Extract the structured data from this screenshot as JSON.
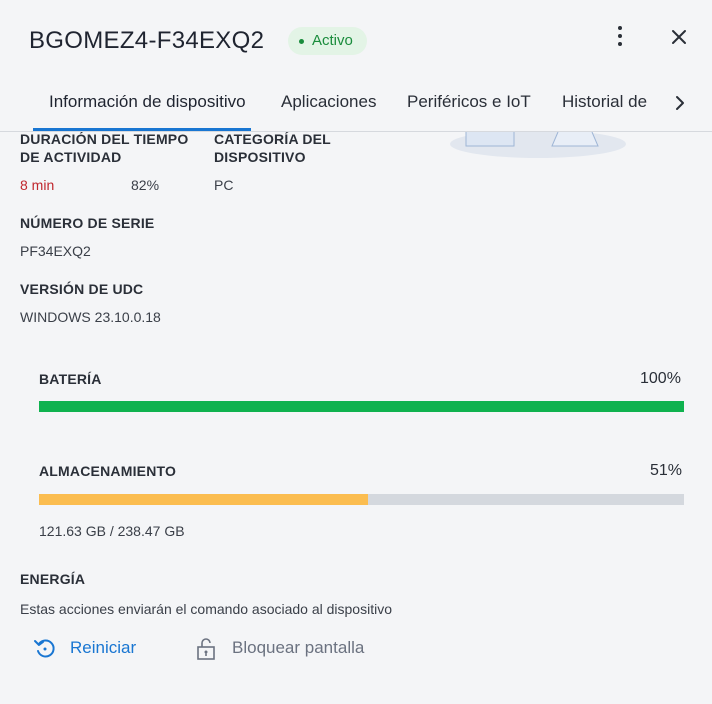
{
  "header": {
    "title": "BGOMEZ4-F34EXQ2",
    "status": "Activo"
  },
  "tabs": [
    {
      "label": "Información de dispositivo",
      "active": true
    },
    {
      "label": "Aplicaciones"
    },
    {
      "label": "Periféricos e IoT"
    },
    {
      "label": "Historial de"
    }
  ],
  "details": {
    "uptime_label_1": "DURACIÓN DEL TIEMPO",
    "uptime_label_2": "DE ACTIVIDAD",
    "uptime_value": "8 min",
    "uptime_percent": "82%",
    "category_label_1": "CATEGORÍA DEL",
    "category_label_2": "DISPOSITIVO",
    "category_value": "PC",
    "serial_label": "NÚMERO DE SERIE",
    "serial_value": "PF34EXQ2",
    "udc_label": "VERSIÓN DE UDC",
    "udc_value": "WINDOWS 23.10.0.18"
  },
  "battery": {
    "label": "BATERÍA",
    "percent_text": "100%",
    "level": 1.0,
    "color": "#0fb24f"
  },
  "storage": {
    "label": "ALMACENAMIENTO",
    "percent_text": "51%",
    "level": 0.51,
    "color": "#fbbd50",
    "usage": "121.63 GB / 238.47 GB"
  },
  "energy": {
    "label": "ENERGÍA",
    "description": "Estas acciones enviarán el comando asociado al dispositivo",
    "restart_label": "Reiniciar",
    "lock_label": "Bloquear pantalla"
  },
  "colors": {
    "accent": "#1976d2",
    "active_badge_bg": "#e3f4e6",
    "active_badge_text": "#1a8c3c",
    "track": "#d4d8de"
  }
}
